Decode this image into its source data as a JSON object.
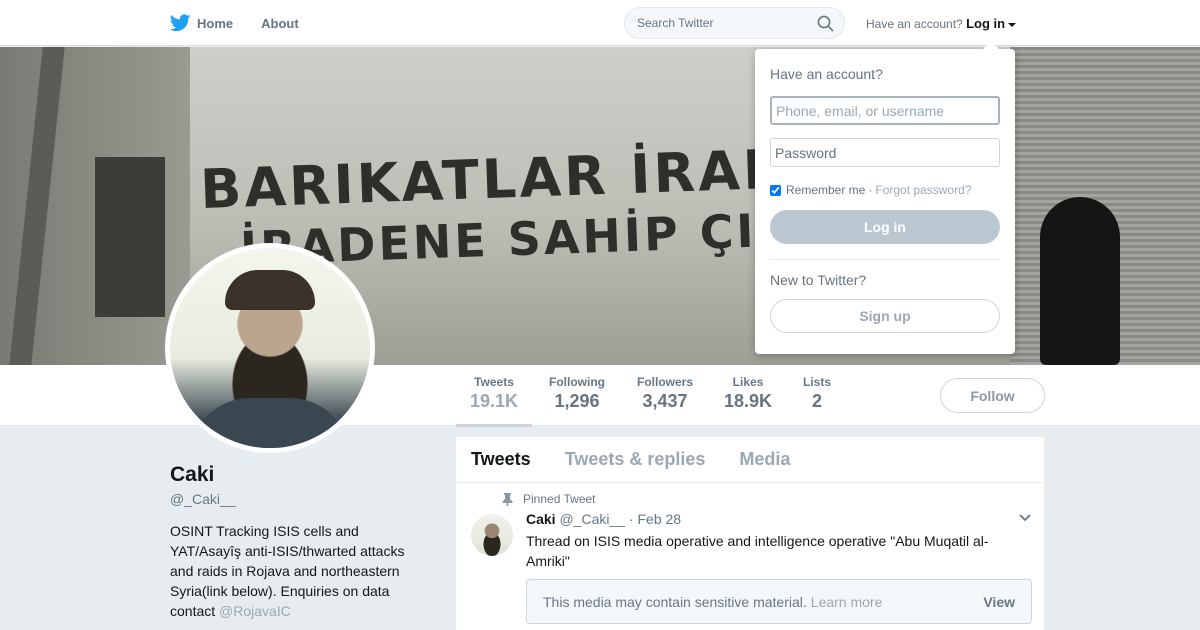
{
  "nav": {
    "home_label": "Home",
    "about_label": "About",
    "search_placeholder": "Search Twitter",
    "have_account": "Have an account?",
    "login_label": "Log in"
  },
  "banner": {
    "graffiti_line1": "BARIKATLAR İRADE",
    "graffiti_line2": "İRADENE SAHİP ÇIK"
  },
  "profile": {
    "name": "Caki",
    "handle": "@_Caki__",
    "bio_text": "OSINT Tracking ISIS cells and YAT/Asayîş anti-ISIS/thwarted attacks and raids in Rojava and northeastern Syria(link below). Enquiries on data contact",
    "bio_mention": "@RojavaIC",
    "follow_label": "Follow"
  },
  "stats": [
    {
      "label": "Tweets",
      "value": "19.1K"
    },
    {
      "label": "Following",
      "value": "1,296"
    },
    {
      "label": "Followers",
      "value": "3,437"
    },
    {
      "label": "Likes",
      "value": "18.9K"
    },
    {
      "label": "Lists",
      "value": "2"
    }
  ],
  "timeline": {
    "tabs": [
      "Tweets",
      "Tweets & replies",
      "Media"
    ],
    "tweet": {
      "pinned_label": "Pinned Tweet",
      "author": "Caki",
      "handle": "@_Caki__",
      "date": "· Feb 28",
      "text": "Thread on ISIS media operative and intelligence operative \"Abu Muqatil al-Amriki\"",
      "sensitive_text": "This media may contain sensitive material.",
      "learn_more": "Learn more",
      "view_label": "View"
    }
  },
  "login_dropdown": {
    "title": "Have an account?",
    "username_placeholder": "Phone, email, or username",
    "password_placeholder": "Password",
    "remember_me": "Remember me",
    "separator": "·",
    "forgot_password": "Forgot password?",
    "login_button": "Log in",
    "new_to_twitter": "New to Twitter?",
    "signup_button": "Sign up"
  },
  "colors": {
    "brand_blue": "#1da1f2",
    "muted_text": "#657786"
  }
}
